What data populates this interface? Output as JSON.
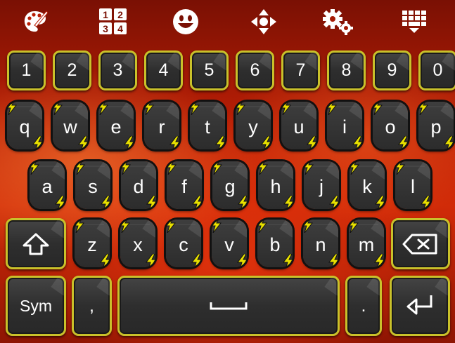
{
  "toolbar": {
    "items": [
      {
        "id": "theme",
        "icon": "palette-icon"
      },
      {
        "id": "numpad",
        "icon": "numpad-icon",
        "digits": [
          "1",
          "2",
          "3",
          "4"
        ]
      },
      {
        "id": "emoji",
        "icon": "smiley-icon"
      },
      {
        "id": "cursor",
        "icon": "move-cursor-icon"
      },
      {
        "id": "settings",
        "icon": "gears-icon"
      },
      {
        "id": "hide",
        "icon": "keyboard-hide-icon"
      }
    ]
  },
  "colors": {
    "key_border": "#c9c12a",
    "key_fill": "#333333",
    "bolt": "#e8e000",
    "background": "#c62408",
    "label": "#ffffff"
  },
  "keyboard": {
    "number_row": [
      "1",
      "2",
      "3",
      "4",
      "5",
      "6",
      "7",
      "8",
      "9",
      "0"
    ],
    "row1": [
      "q",
      "w",
      "e",
      "r",
      "t",
      "y",
      "u",
      "i",
      "o",
      "p"
    ],
    "row2": [
      "a",
      "s",
      "d",
      "f",
      "g",
      "h",
      "j",
      "k",
      "l"
    ],
    "row3": [
      "z",
      "x",
      "c",
      "v",
      "b",
      "n",
      "m"
    ],
    "shift_icon": "shift-arrow-icon",
    "backspace_icon": "backspace-icon",
    "sym_label": "Sym",
    "comma_label": ",",
    "space_icon": "space-bar-icon",
    "period_label": ".",
    "enter_icon": "enter-return-icon"
  }
}
